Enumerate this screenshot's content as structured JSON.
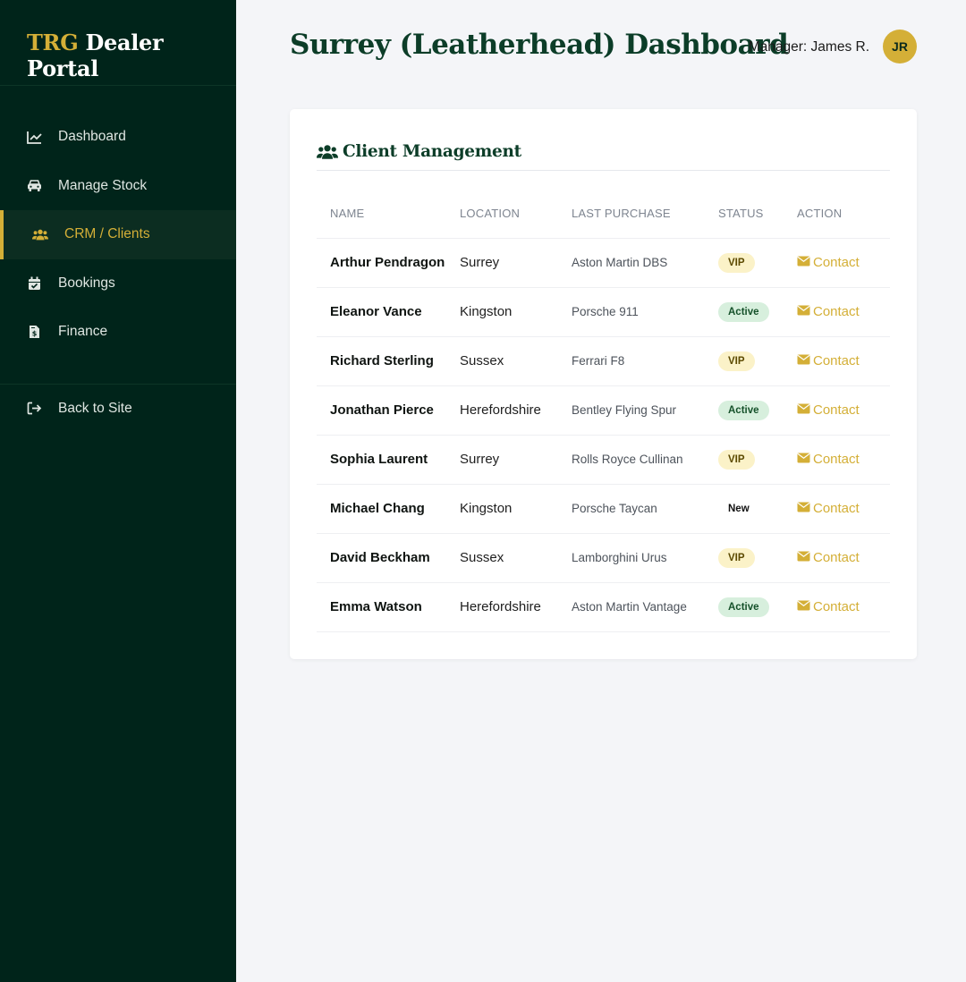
{
  "brand": {
    "prefix": "TRG",
    "name": "Dealer Portal"
  },
  "nav": {
    "items": [
      {
        "label": "Dashboard",
        "icon": "chart-line-icon"
      },
      {
        "label": "Manage Stock",
        "icon": "car-icon"
      },
      {
        "label": "CRM / Clients",
        "icon": "users-icon",
        "active": true
      },
      {
        "label": "Bookings",
        "icon": "calendar-check-icon"
      },
      {
        "label": "Finance",
        "icon": "invoice-dollar-icon"
      }
    ],
    "back": {
      "label": "Back to Site",
      "icon": "sign-out-icon"
    }
  },
  "header": {
    "title": "Surrey (Leatherhead) Dashboard",
    "manager": "Manager: James R.",
    "avatar_initials": "JR"
  },
  "crm": {
    "title": "Client Management",
    "icon": "users-icon",
    "columns": [
      "NAME",
      "LOCATION",
      "LAST PURCHASE",
      "STATUS",
      "ACTION"
    ],
    "rows": [
      {
        "name": "Arthur Pendragon",
        "location": "Surrey",
        "car": "Aston Martin DBS",
        "status": "VIP",
        "action": "Contact"
      },
      {
        "name": "Eleanor Vance",
        "location": "Kingston",
        "car": "Porsche 911",
        "status": "Active",
        "action": "Contact"
      },
      {
        "name": "Richard Sterling",
        "location": "Sussex",
        "car": "Ferrari F8",
        "status": "VIP",
        "action": "Contact"
      },
      {
        "name": "Jonathan Pierce",
        "location": "Herefordshire",
        "car": "Bentley Flying Spur",
        "status": "Active",
        "action": "Contact"
      },
      {
        "name": "Sophia Laurent",
        "location": "Surrey",
        "car": "Rolls Royce Cullinan",
        "status": "VIP",
        "action": "Contact"
      },
      {
        "name": "Michael Chang",
        "location": "Kingston",
        "car": "Porsche Taycan",
        "status": "New",
        "action": "Contact"
      },
      {
        "name": "David Beckham",
        "location": "Sussex",
        "car": "Lamborghini Urus",
        "status": "VIP",
        "action": "Contact"
      },
      {
        "name": "Emma Watson",
        "location": "Herefordshire",
        "car": "Aston Martin Vantage",
        "status": "Active",
        "action": "Contact"
      }
    ]
  },
  "colors": {
    "sidebar": "#00241a",
    "accent": "#d4af37",
    "heading": "#0c3d28",
    "background": "#f4f5f8"
  }
}
